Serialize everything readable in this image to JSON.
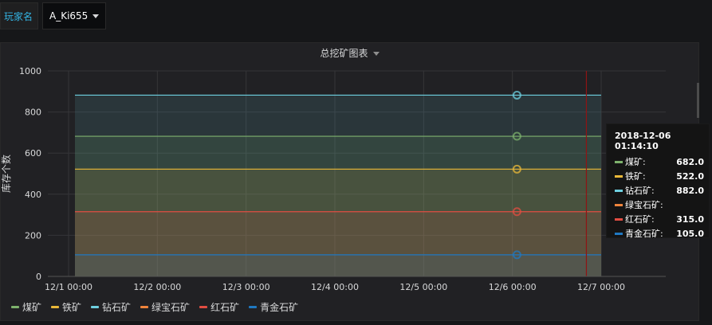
{
  "variable": {
    "label": "玩家名",
    "value": "A_Ki655"
  },
  "panel": {
    "title": "总挖矿图表"
  },
  "chart_data": {
    "type": "area",
    "title": "总挖矿图表",
    "xlabel": "",
    "ylabel": "库存个数",
    "x_ticks": [
      "12/1 00:00",
      "12/2 00:00",
      "12/3 00:00",
      "12/4 00:00",
      "12/5 00:00",
      "12/6 00:00",
      "12/7 00:00"
    ],
    "y_ticks": [
      "0",
      "200",
      "400",
      "600",
      "800",
      "1000"
    ],
    "ylim": [
      0,
      1000
    ],
    "xlim": [
      "2018-12-01 00:00",
      "2018-12-07 00:00"
    ],
    "grid": true,
    "legend_position": "bottom",
    "series": [
      {
        "name": "煤矿",
        "color": "#7eb26d",
        "values": [
          682,
          682
        ]
      },
      {
        "name": "铁矿",
        "color": "#eab839",
        "values": [
          522,
          522
        ]
      },
      {
        "name": "钻石矿",
        "color": "#6ed0e0",
        "values": [
          882,
          882
        ]
      },
      {
        "name": "绿宝石矿",
        "color": "#ef843c",
        "values": []
      },
      {
        "name": "红石矿",
        "color": "#e24d42",
        "values": [
          315,
          315
        ]
      },
      {
        "name": "青金石矿",
        "color": "#1f78c1",
        "values": [
          105,
          105
        ]
      }
    ],
    "series_x": [
      "2018-12-01 00:00",
      "2018-12-06 23:59"
    ],
    "crosshair_time": "2018-12-06 01:14",
    "now_marker_time": "2018-12-06 20:00"
  },
  "tooltip": {
    "time": "2018-12-06 01:14:10",
    "rows": [
      {
        "name": "煤矿:",
        "value": "682.0",
        "color": "#7eb26d"
      },
      {
        "name": "铁矿:",
        "value": "522.0",
        "color": "#eab839"
      },
      {
        "name": "钻石矿:",
        "value": "882.0",
        "color": "#6ed0e0"
      },
      {
        "name": "绿宝石矿:",
        "value": "",
        "color": "#ef843c"
      },
      {
        "name": "红石矿:",
        "value": "315.0",
        "color": "#e24d42"
      },
      {
        "name": "青金石矿:",
        "value": "105.0",
        "color": "#1f78c1"
      }
    ]
  }
}
